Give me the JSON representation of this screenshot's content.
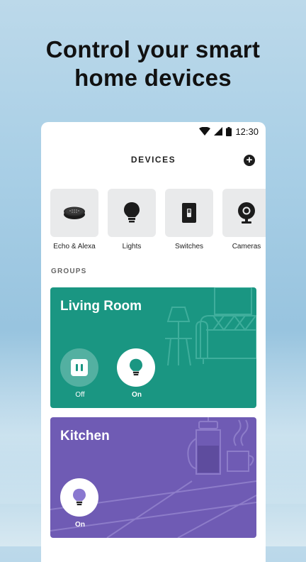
{
  "headline": {
    "line1": "Control your smart",
    "line2": "home devices"
  },
  "status_bar": {
    "time": "12:30",
    "icons": [
      "wifi-icon",
      "cell-signal-icon",
      "battery-icon"
    ]
  },
  "app_bar": {
    "title": "DEVICES",
    "add_icon": "plus-icon"
  },
  "categories": [
    {
      "label": "Echo & Alexa",
      "icon": "echo-dot-icon"
    },
    {
      "label": "Lights",
      "icon": "light-bulb-icon"
    },
    {
      "label": "Switches",
      "icon": "light-switch-icon"
    },
    {
      "label": "Cameras",
      "icon": "camera-icon"
    }
  ],
  "groups_label": "GROUPS",
  "groups": [
    {
      "name": "Living Room",
      "color": "#1a9682",
      "devices": [
        {
          "icon": "smart-plug-icon",
          "state": "Off"
        },
        {
          "icon": "light-bulb-icon",
          "state": "On"
        }
      ]
    },
    {
      "name": "Kitchen",
      "color": "#6f5bb4",
      "devices": [
        {
          "icon": "light-bulb-icon",
          "state": "On"
        }
      ]
    }
  ],
  "colors": {
    "living_room": "#1a9682",
    "kitchen": "#6f5bb4",
    "tile_bg": "#e9eaeb"
  }
}
